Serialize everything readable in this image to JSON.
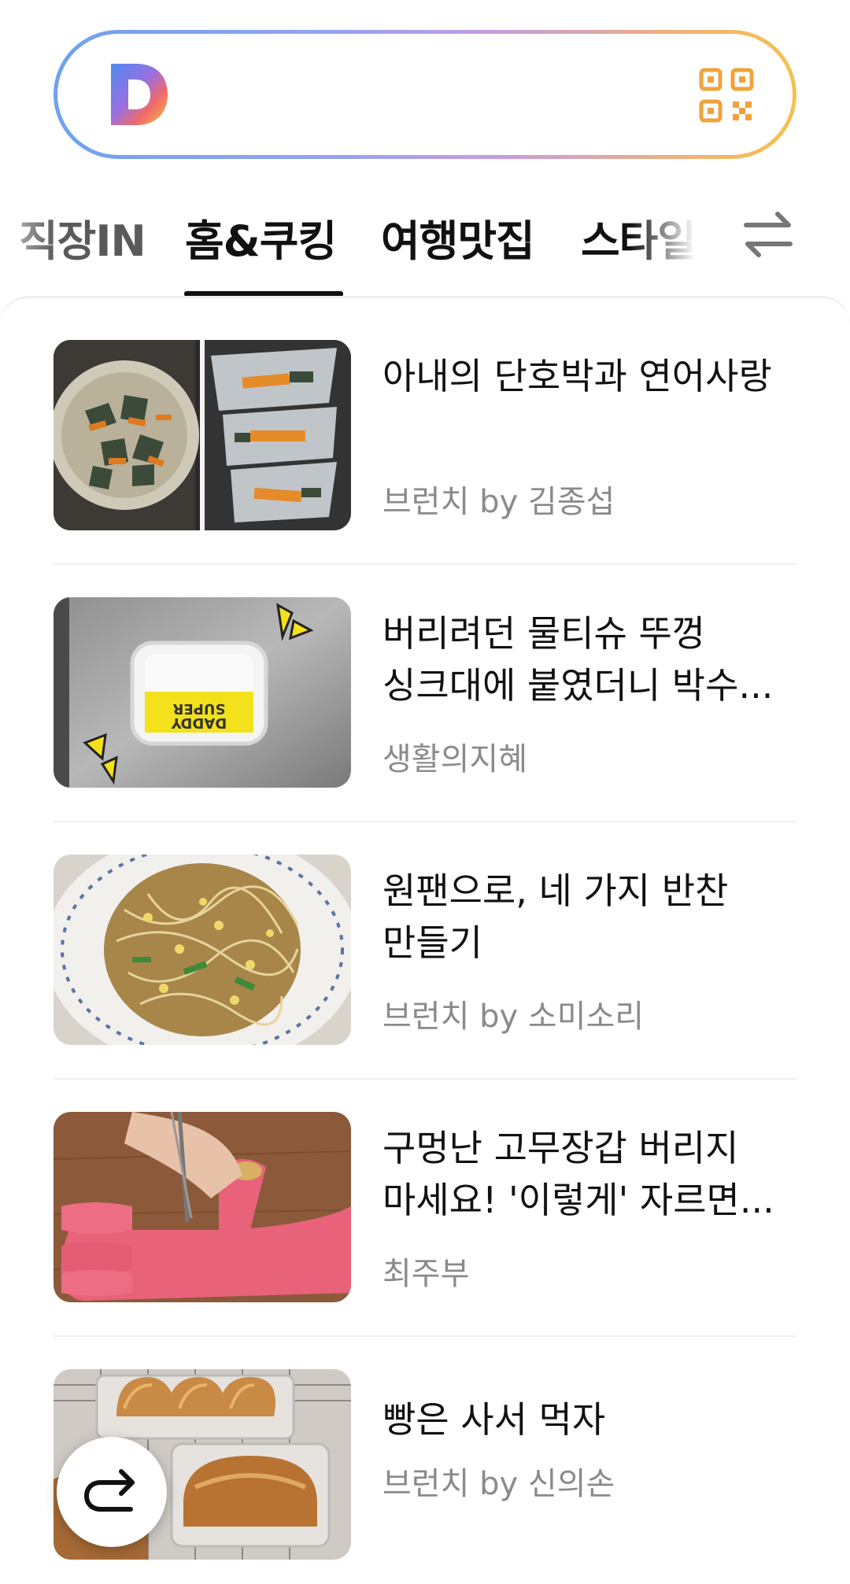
{
  "search": {
    "logo_icon": "daum-d-logo-icon",
    "qr_icon": "qr-code-icon"
  },
  "tabs": [
    {
      "label": "직장IN",
      "selected": false
    },
    {
      "label": "홈&쿠킹",
      "selected": true
    },
    {
      "label": "여행맛집",
      "selected": false
    },
    {
      "label": "스타일",
      "selected": false
    }
  ],
  "tabs_edit_icon": "swap-arrows-icon",
  "articles": [
    {
      "title": "아내의 단호박과 연어사랑",
      "source": "브런치 by 김종섭",
      "thumb_icon": "steamed-pumpkin-photo"
    },
    {
      "title": "버리려던 물티슈 뚜껑 싱크대에 붙였더니 박수...",
      "source": "생활의지혜",
      "thumb_icon": "wet-wipe-lid-photo"
    },
    {
      "title": "원팬으로, 네 가지 반찬 만들기",
      "source": "브런치 by 소미소리",
      "thumb_icon": "bean-sprout-dish-photo"
    },
    {
      "title": "구멍난 고무장갑 버리지 마세요! '이렇게' 자르면...",
      "source": "최주부",
      "thumb_icon": "rubber-glove-photo"
    },
    {
      "title": "빵은 사서 먹자",
      "source": "브런치 by 신의손",
      "thumb_icon": "bread-loaves-photo"
    }
  ],
  "fab_icon": "redo-arrow-icon",
  "colors": {
    "accent_text": "#111111",
    "meta_text": "#8a8a8a",
    "search_gradient": [
      "#6fa2ef",
      "#c79ce0",
      "#f5c150"
    ],
    "qr_orange": "#f0a23c"
  }
}
